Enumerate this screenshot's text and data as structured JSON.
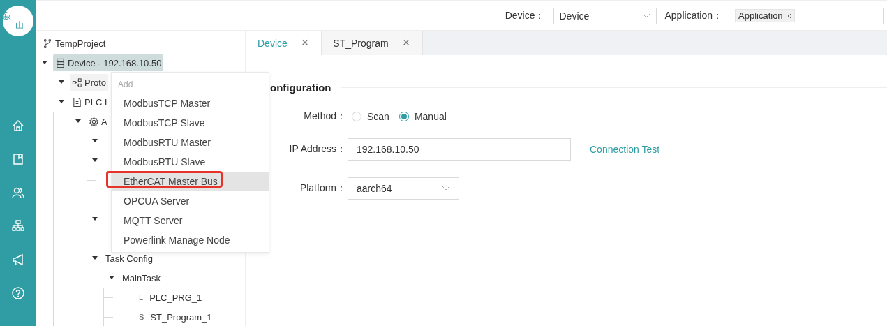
{
  "logo": {
    "text_top": "寂",
    "text_bottom": "山"
  },
  "top_bar": {
    "device_label": "Device：",
    "device_select": "Device",
    "application_label": "Application：",
    "application_tags": [
      "Application"
    ]
  },
  "tree": [
    {
      "label": "TempProject",
      "kind": "project",
      "children": [
        {
          "label": "Device - 192.168.10.50",
          "kind": "device",
          "expanded": true,
          "selected": true,
          "children": [
            {
              "label": "Proto",
              "kind": "protocol",
              "expanded": true,
              "hovered": true
            },
            {
              "label": "PLC L",
              "kind": "plc",
              "expanded": true,
              "children": [
                {
                  "label": "A",
                  "kind": "application",
                  "expanded": true,
                  "children": [
                    {
                      "kind": "folder",
                      "expanded": true
                    },
                    {
                      "kind": "folder",
                      "expanded": true,
                      "children": [
                        {
                          "kind": "leaf"
                        },
                        {
                          "kind": "leaf"
                        }
                      ]
                    },
                    {
                      "kind": "folder",
                      "expanded": true,
                      "children": [
                        {
                          "kind": "leaf"
                        }
                      ]
                    },
                    {
                      "label": "Task Config",
                      "kind": "folder",
                      "expanded": true,
                      "children": [
                        {
                          "label": "MainTask",
                          "kind": "folder",
                          "expanded": true,
                          "children": [
                            {
                              "label": "PLC_PRG_1",
                              "badge": "L",
                              "kind": "leaf"
                            },
                            {
                              "label": "ST_Program_1",
                              "badge": "S",
                              "kind": "leaf"
                            }
                          ]
                        }
                      ]
                    }
                  ]
                }
              ]
            }
          ]
        }
      ]
    }
  ],
  "context_menu": {
    "header": "Add",
    "items": [
      {
        "label": "ModbusTCP Master",
        "highlighted": false
      },
      {
        "label": "ModbusTCP Slave",
        "highlighted": false
      },
      {
        "label": "ModbusRTU Master",
        "highlighted": false
      },
      {
        "label": "ModbusRTU Slave",
        "highlighted": false
      },
      {
        "label": "EtherCAT Master Bus",
        "highlighted": true
      },
      {
        "label": "OPCUA Server",
        "highlighted": false
      },
      {
        "label": "MQTT Server",
        "highlighted": false
      },
      {
        "label": "Powerlink Manage Node",
        "highlighted": false
      }
    ]
  },
  "tabs": [
    {
      "label": "Device",
      "selected": true,
      "close": "×"
    },
    {
      "label": "ST_Program",
      "selected": false,
      "close": "×"
    }
  ],
  "form": {
    "section_title": "onfiguration",
    "method_label": "Method：",
    "method_options": [
      {
        "label": "Scan",
        "selected": false
      },
      {
        "label": "Manual",
        "selected": true
      }
    ],
    "ip_label": "IP Address：",
    "ip_value": "192.168.10.50",
    "connection_test": "Connection Test",
    "platform_label": "Platform：",
    "platform_value": "aarch64"
  }
}
